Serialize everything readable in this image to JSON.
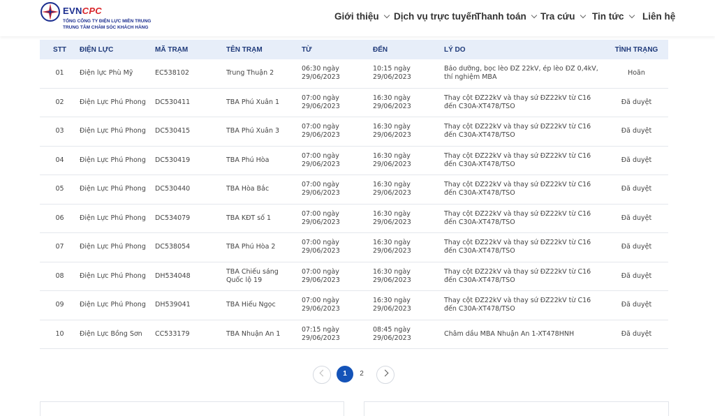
{
  "brand": {
    "name_part1": "EVN",
    "name_part2": "CPC",
    "line1": "TỔNG CÔNG TY ĐIỆN LỰC MIỀN TRUNG",
    "line2": "TRUNG TÂM CHĂM SÓC KHÁCH HÀNG"
  },
  "nav": [
    {
      "label": "Giới thiệu",
      "has_dropdown": true
    },
    {
      "label": "Dịch vụ trực tuyến",
      "has_dropdown": false
    },
    {
      "label": "Thanh toán",
      "has_dropdown": true
    },
    {
      "label": "Tra cứu",
      "has_dropdown": true
    },
    {
      "label": "Tin tức",
      "has_dropdown": true
    },
    {
      "label": "Liên hệ",
      "has_dropdown": false
    }
  ],
  "table": {
    "headers": [
      "STT",
      "ĐIỆN LỰC",
      "MÃ TRẠM",
      "TÊN TRẠM",
      "TỪ",
      "ĐẾN",
      "LÝ DO",
      "TÌNH TRẠNG"
    ],
    "rows": [
      {
        "stt": "01",
        "dien_luc": "Điện lực Phù Mỹ",
        "ma_tram": "EC538102",
        "ten_tram": "Trung Thuận 2",
        "tu": "06:30 ngày 29/06/2023",
        "den": "10:15 ngày 29/06/2023",
        "ly_do": "Bảo dưỡng, bọc lèo ĐZ 22kV, ép lèo ĐZ 0,4kV, thí nghiệm MBA",
        "tinh_trang": "Hoãn"
      },
      {
        "stt": "02",
        "dien_luc": "Điện Lực Phú Phong",
        "ma_tram": "DC530411",
        "ten_tram": "TBA Phú Xuân 1",
        "tu": "07:00 ngày 29/06/2023",
        "den": "16:30 ngày 29/06/2023",
        "ly_do": "Thay cột ĐZ22kV và thay sứ ĐZ22kV từ C16 đến C30A-XT478/TSO",
        "tinh_trang": "Đã duyệt"
      },
      {
        "stt": "03",
        "dien_luc": "Điện Lực Phú Phong",
        "ma_tram": "DC530415",
        "ten_tram": "TBA Phú Xuân 3",
        "tu": "07:00 ngày 29/06/2023",
        "den": "16:30 ngày 29/06/2023",
        "ly_do": "Thay cột ĐZ22kV và thay sứ ĐZ22kV từ C16 đến C30A-XT478/TSO",
        "tinh_trang": "Đã duyệt"
      },
      {
        "stt": "04",
        "dien_luc": "Điện Lực Phú Phong",
        "ma_tram": "DC530419",
        "ten_tram": "TBA Phú Hòa",
        "tu": "07:00 ngày 29/06/2023",
        "den": "16:30 ngày 29/06/2023",
        "ly_do": "Thay cột ĐZ22kV và thay sứ ĐZ22kV từ C16 đến C30A-XT478/TSO",
        "tinh_trang": "Đã duyệt"
      },
      {
        "stt": "05",
        "dien_luc": "Điện Lực Phú Phong",
        "ma_tram": "DC530440",
        "ten_tram": "TBA Hòa Bắc",
        "tu": "07:00 ngày 29/06/2023",
        "den": "16:30 ngày 29/06/2023",
        "ly_do": "Thay cột ĐZ22kV và thay sứ ĐZ22kV từ C16 đến C30A-XT478/TSO",
        "tinh_trang": "Đã duyệt"
      },
      {
        "stt": "06",
        "dien_luc": "Điện Lực Phú Phong",
        "ma_tram": "DC534079",
        "ten_tram": "TBA KĐT số 1",
        "tu": "07:00 ngày 29/06/2023",
        "den": "16:30 ngày 29/06/2023",
        "ly_do": "Thay cột ĐZ22kV và thay sứ ĐZ22kV từ C16 đến C30A-XT478/TSO",
        "tinh_trang": "Đã duyệt"
      },
      {
        "stt": "07",
        "dien_luc": "Điện Lực Phú Phong",
        "ma_tram": "DC538054",
        "ten_tram": "TBA Phú Hòa 2",
        "tu": "07:00 ngày 29/06/2023",
        "den": "16:30 ngày 29/06/2023",
        "ly_do": "Thay cột ĐZ22kV và thay sứ ĐZ22kV từ C16 đến C30A-XT478/TSO",
        "tinh_trang": "Đã duyệt"
      },
      {
        "stt": "08",
        "dien_luc": "Điện Lực Phú Phong",
        "ma_tram": "DH534048",
        "ten_tram": "TBA Chiếu sáng Quốc lộ 19",
        "tu": "07:00 ngày 29/06/2023",
        "den": "16:30 ngày 29/06/2023",
        "ly_do": "Thay cột ĐZ22kV và thay sứ ĐZ22kV từ C16 đến C30A-XT478/TSO",
        "tinh_trang": "Đã duyệt"
      },
      {
        "stt": "09",
        "dien_luc": "Điện Lực Phú Phong",
        "ma_tram": "DH539041",
        "ten_tram": "TBA Hiếu Ngọc",
        "tu": "07:00 ngày 29/06/2023",
        "den": "16:30 ngày 29/06/2023",
        "ly_do": "Thay cột ĐZ22kV và thay sứ ĐZ22kV từ C16 đến C30A-XT478/TSO",
        "tinh_trang": "Đã duyệt"
      },
      {
        "stt": "10",
        "dien_luc": "Điện Lực Bồng Sơn",
        "ma_tram": "CC533179",
        "ten_tram": "TBA Nhuận An 1",
        "tu": "07:15 ngày 29/06/2023",
        "den": "08:45 ngày 29/06/2023",
        "ly_do": "Châm dầu MBA Nhuận An 1-XT478HNH",
        "tinh_trang": "Đã duyệt"
      }
    ]
  },
  "pagination": {
    "pages": [
      "1",
      "2"
    ],
    "current": "1"
  },
  "colors": {
    "brand_blue": "#1b2e8f",
    "brand_red": "#d9262b",
    "header_bg": "#e7eef9",
    "active_page": "#1453b8"
  }
}
